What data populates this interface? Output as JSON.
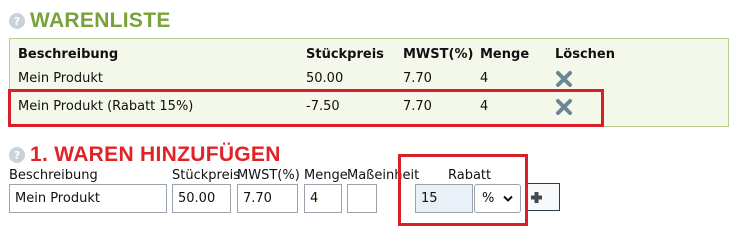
{
  "warenliste": {
    "title": "WARENLISTE",
    "help_icon": "question-icon",
    "columns": {
      "description": "Beschreibung",
      "unit_price": "Stückpreis",
      "vat": "MWST(%)",
      "quantity": "Menge",
      "delete": "Löschen"
    },
    "rows": [
      {
        "description": "Mein Produkt",
        "unit_price": "50.00",
        "vat": "7.70",
        "quantity": "4",
        "delete_icon": "close-x-icon"
      },
      {
        "description": "Mein Produkt (Rabatt 15%)",
        "unit_price": "-7.50",
        "vat": "7.70",
        "quantity": "4",
        "delete_icon": "close-x-icon"
      }
    ]
  },
  "add_goods": {
    "title": "1. WAREN HINZUFÜGEN",
    "help_icon": "question-icon",
    "labels": {
      "description": "Beschreibung",
      "unit_price": "Stückpreis",
      "vat": "MWST(%)",
      "quantity": "Menge",
      "unit": "Maßeinheit",
      "discount": "Rabatt"
    },
    "values": {
      "description": "Mein Produkt",
      "unit_price": "50.00",
      "vat": "7.70",
      "quantity": "4",
      "unit": "",
      "discount": "15",
      "discount_type": "%"
    },
    "add_icon": "plus-icon"
  },
  "colors": {
    "green_title": "#7aa23a",
    "red_title": "#e12326",
    "highlight": "#d91f2a",
    "list_bg": "#f3f8ea",
    "delete_icon": "#6b8796"
  }
}
